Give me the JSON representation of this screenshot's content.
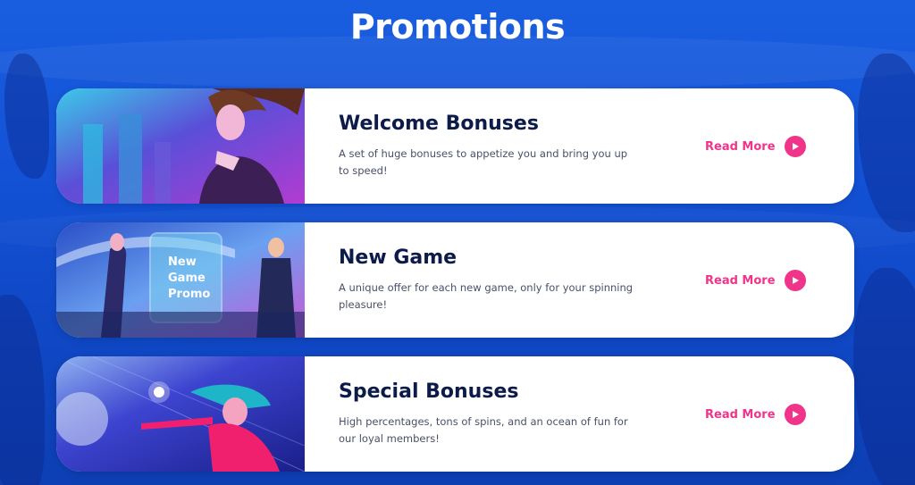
{
  "page": {
    "title": "Promotions"
  },
  "promotions": [
    {
      "title": "Welcome Bonuses",
      "description": "A set of huge bonuses to appetize you and bring you up to speed!",
      "read_more_label": "Read More",
      "image_icon": "woman-city-illustration"
    },
    {
      "title": "New Game",
      "description": "A unique offer for each new game, only for your spinning pleasure!",
      "read_more_label": "Read More",
      "image_icon": "new-game-promo-illustration",
      "image_text": "New Game Promo"
    },
    {
      "title": "Special Bonuses",
      "description": "High percentages, tons of spins, and an ocean of fun for our loyal members!",
      "read_more_label": "Read More",
      "image_icon": "mermaid-illustration"
    }
  ],
  "colors": {
    "background": "#1352d6",
    "accent": "#f0348a",
    "heading": "#0d1b4a",
    "text": "#4a5068"
  }
}
